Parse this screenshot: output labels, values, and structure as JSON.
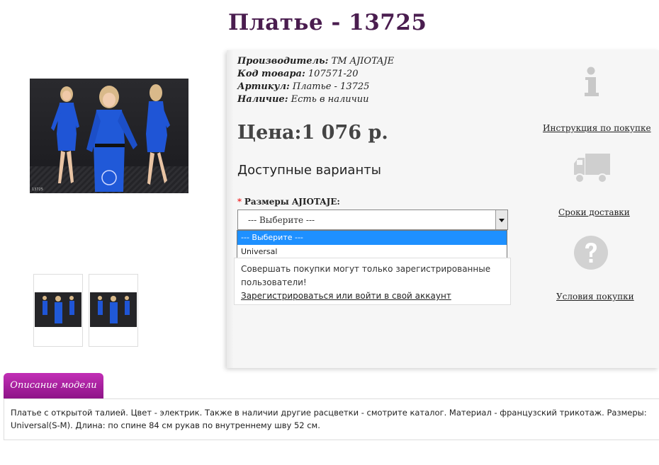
{
  "product": {
    "title": "Платье - 13725",
    "manufacturer_label": "Производитель:",
    "manufacturer_value": "ТМ AJIOTAJE",
    "code_label": "Код товара:",
    "code_value": "107571-20",
    "article_label": "Артикул:",
    "article_value": "Платье - 13725",
    "availability_label": "Наличие:",
    "availability_value": "Есть в наличии",
    "price": "Цена:1 076 р."
  },
  "options": {
    "heading": "Доступные варианты",
    "required_mark": "*",
    "size_label": "Размеры AJIOTAJE:",
    "selected": "--- Выберите ---",
    "items": [
      "--- Выберите ---",
      "Universal"
    ]
  },
  "login": {
    "message": "Совершать покупки могут только зарегистрированные пользователи!",
    "link": "Зарегистрироваться или войти в свой аккаунт"
  },
  "side": {
    "instruction": "Инструкция по покупке",
    "delivery": "Сроки доставки",
    "conditions": "Условия покупки"
  },
  "tabs": {
    "description_tab": "Описание модели"
  },
  "description": {
    "text": "Платье с открытой талией. Цвет - электрик. Также в наличии другие расцветки - смотрите каталог. Материал - французский трикотаж. Размеры: Universal(S-M). Длина: по спине 84 см рукав по внутреннему шву 52 см."
  },
  "colors": {
    "title": "#4a1d4f",
    "dress": "#1f55d6",
    "tab": "#a81c9e",
    "highlight": "#1e90ff"
  },
  "icons": [
    "info-icon",
    "truck-icon",
    "question-icon",
    "chevron-down-icon"
  ]
}
